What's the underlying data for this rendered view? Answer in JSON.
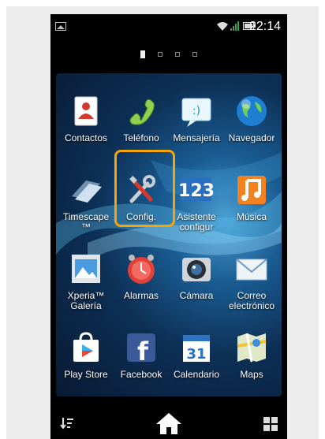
{
  "status_bar": {
    "time": "22:14",
    "icons": [
      "picture-icon",
      "wifi-icon",
      "signal-icon",
      "battery-icon"
    ]
  },
  "home": {
    "pages": 4,
    "active_page": 1
  },
  "apps": [
    {
      "name": "contactos",
      "label": "Contactos",
      "icon": "contacts-icon"
    },
    {
      "name": "telefono",
      "label": "Teléfono",
      "icon": "phone-icon"
    },
    {
      "name": "mensajeria",
      "label": "Mensajería",
      "icon": "messaging-icon"
    },
    {
      "name": "navegador",
      "label": "Navegador",
      "icon": "browser-globe-icon"
    },
    {
      "name": "timescape",
      "label": "Timescape™",
      "icon": "timescape-icon"
    },
    {
      "name": "config",
      "label": "Config.",
      "icon": "settings-tools-icon",
      "highlighted": true
    },
    {
      "name": "asistente",
      "label": "Asistente configur",
      "icon": "setup-assistant-icon"
    },
    {
      "name": "musica",
      "label": "Música",
      "icon": "music-icon"
    },
    {
      "name": "xperia-galeria",
      "label": "Xperia™ Galería",
      "icon": "gallery-icon"
    },
    {
      "name": "alarmas",
      "label": "Alarmas",
      "icon": "alarm-clock-icon"
    },
    {
      "name": "camara",
      "label": "Cámara",
      "icon": "camera-icon"
    },
    {
      "name": "correo",
      "label": "Correo electrónico",
      "icon": "email-icon"
    },
    {
      "name": "play-store",
      "label": "Play Store",
      "icon": "play-store-icon"
    },
    {
      "name": "facebook",
      "label": "Facebook",
      "icon": "facebook-icon"
    },
    {
      "name": "calendario",
      "label": "Calendario",
      "icon": "calendar-icon"
    },
    {
      "name": "maps",
      "label": "Maps",
      "icon": "maps-icon"
    }
  ],
  "icon_text": {
    "setup_number": "123",
    "calendar_day": "31",
    "facebook_letter": "f"
  },
  "nav_bar": {
    "left": "sort-icon",
    "center": "home-icon",
    "right": "app-grid-icon"
  },
  "colors": {
    "highlight": "#f5a50a",
    "background": "#000000"
  }
}
